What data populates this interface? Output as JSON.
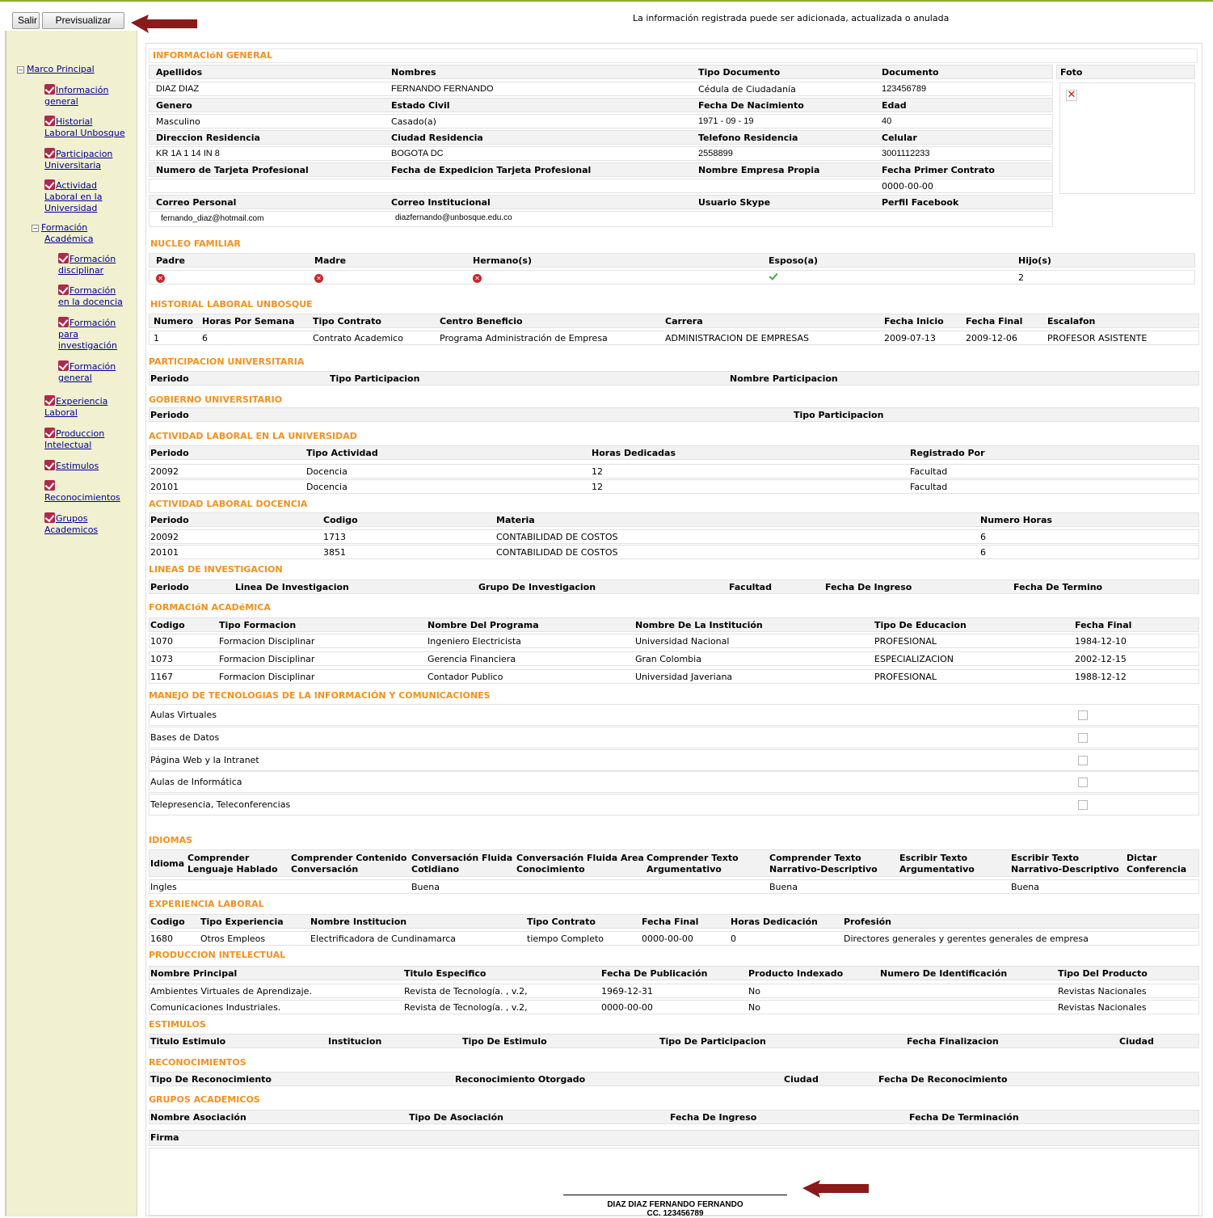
{
  "toolbar": {
    "exit_label": "Salir",
    "preview_label": "Previsualizar"
  },
  "notice": "La información registrada puede ser adicionada, actualizada o anulada",
  "tree": {
    "root": "Marco Principal",
    "items": [
      {
        "l1": "Información",
        "l2": "general"
      },
      {
        "l1": "Historial",
        "l2": "Laboral Unbosque"
      },
      {
        "l1": "Participacion",
        "l2": "Universitaria"
      },
      {
        "l1": "Actividad",
        "l2": "Laboral en la",
        "l3": "Universidad"
      },
      {
        "l1": "Formación",
        "l2": "Académica"
      },
      {
        "l1": "Formación",
        "l2": "disciplinar"
      },
      {
        "l1": "Formación",
        "l2": "en la docencia"
      },
      {
        "l1": "Formación",
        "l2": "para",
        "l3": "investigación"
      },
      {
        "l1": "Formación",
        "l2": "general"
      },
      {
        "l1": "Experiencia",
        "l2": "Laboral"
      },
      {
        "l1": "Produccion",
        "l2": "Intelectual"
      },
      {
        "l1": "Estimulos"
      },
      {
        "l1": "",
        "l2": "Reconocimientos"
      },
      {
        "l1": "Grupos",
        "l2": "Academicos"
      }
    ]
  },
  "general": {
    "title": "INFORMACIóN GENERAL",
    "h1": [
      "Apellidos",
      "Nombres",
      "Tipo Documento",
      "Documento",
      "Foto"
    ],
    "v1": [
      "DIAZ DIAZ",
      "FERNANDO FERNANDO",
      "Cédula de Ciudadanía",
      "123456789"
    ],
    "h2": [
      "Genero",
      "Estado Civil",
      "Fecha De Nacimiento",
      "Edad"
    ],
    "v2": [
      "Masculino",
      "Casado(a)",
      "1971 - 09 - 19",
      "40"
    ],
    "h3": [
      "Direccion Residencia",
      "Ciudad Residencia",
      "Telefono Residencia",
      "Celular"
    ],
    "v3": [
      "KR 1A 1 14 IN 8",
      "BOGOTA DC",
      "2558899",
      "3001112233"
    ],
    "h4": [
      "Numero de Tarjeta Profesional",
      "Fecha de Expedicion Tarjeta Profesional",
      "Nombre Empresa Propia",
      "Fecha Primer Contrato"
    ],
    "v4": [
      "",
      "",
      "",
      "0000-00-00"
    ],
    "h5": [
      "Correo Personal",
      "Correo Institucional",
      "Usuario Skype",
      "Perfil Facebook"
    ],
    "v5": [
      "fernando_diaz@hotmail.com",
      "diazfernando@unbosque.edu.co",
      "",
      ""
    ],
    "photo_missing": "✕"
  },
  "family": {
    "title": "NUCLEO FAMILIAR",
    "headers": [
      "Padre",
      "Madre",
      "Hermano(s)",
      "Esposo(a)",
      "Hijo(s)"
    ],
    "children_count": "2"
  },
  "history": {
    "title": "HISTORIAL LABORAL UNBOSQUE",
    "headers": [
      "Numero",
      "Horas Por Semana",
      "Tipo Contrato",
      "Centro Beneficio",
      "Carrera",
      "Fecha Inicio",
      "Fecha Final",
      "Escalafon"
    ],
    "row": [
      "1",
      "6",
      "Contrato Academico",
      "Programa Administración de Empresa",
      "ADMINISTRACION DE EMPRESAS",
      "2009-07-13",
      "2009-12-06",
      "PROFESOR ASISTENTE"
    ]
  },
  "participation": {
    "title": "PARTICIPACION UNIVERSITARIA",
    "headers": [
      "Periodo",
      "Tipo Participacion",
      "Nombre Participacion"
    ]
  },
  "government": {
    "title": "GOBIERNO UNIVERSITARIO",
    "headers": [
      "Periodo",
      "Tipo Participacion"
    ]
  },
  "activity": {
    "title": "ACTIVIDAD LABORAL EN LA UNIVERSIDAD",
    "headers": [
      "Periodo",
      "Tipo Actividad",
      "Horas Dedicadas",
      "Registrado Por"
    ],
    "rows": [
      [
        "20092",
        "Docencia",
        "12",
        "Facultad"
      ],
      [
        "20101",
        "Docencia",
        "12",
        "Facultad"
      ]
    ]
  },
  "teaching": {
    "title": "ACTIVIDAD LABORAL DOCENCIA",
    "headers": [
      "Periodo",
      "Codigo",
      "Materia",
      "Numero Horas"
    ],
    "rows": [
      [
        "20092",
        "1713",
        "CONTABILIDAD DE COSTOS",
        "6"
      ],
      [
        "20101",
        "3851",
        "CONTABILIDAD DE COSTOS",
        "6"
      ]
    ]
  },
  "research": {
    "title": "LINEAS DE INVESTIGACION",
    "headers": [
      "Periodo",
      "Linea De Investigacion",
      "Grupo De Investigacion",
      "Facultad",
      "Fecha De Ingreso",
      "Fecha De Termino"
    ]
  },
  "academic": {
    "title": "FORMACIóN ACADéMICA",
    "headers": [
      "Codigo",
      "Tipo Formacion",
      "Nombre Del Programa",
      "Nombre De La Institución",
      "Tipo De Educacion",
      "Fecha Final"
    ],
    "rows": [
      [
        "1070",
        "Formacion Disciplinar",
        "Ingeniero Electricista",
        "Universidad Nacional",
        "PROFESIONAL",
        "1984-12-10"
      ],
      [
        "1073",
        "Formacion Disciplinar",
        "Gerencia Financiera",
        "Gran Colombia",
        "ESPECIALIZACION",
        "2002-12-15"
      ],
      [
        "1167",
        "Formacion Disciplinar",
        "Contador Publico",
        "Universidad Javeriana",
        "PROFESIONAL",
        "1988-12-12"
      ]
    ]
  },
  "tic": {
    "title": "MANEJO DE TECNOLOGIAS DE LA INFORMACIÓN Y COMUNICACIONES",
    "items": [
      "Aulas Virtuales",
      "Bases de Datos",
      "Página Web y la Intranet",
      "Aulas de Informática",
      "Telepresencia, Teleconferencias"
    ]
  },
  "languages": {
    "title": "IDIOMAS",
    "headers": [
      [
        "Idioma"
      ],
      [
        "Comprender",
        "Lenguaje Hablado"
      ],
      [
        "Comprender Contenido",
        "Conversación"
      ],
      [
        "Conversación Fluida",
        "Cotidiano"
      ],
      [
        "Conversación Fluida Area",
        "Conocimiento"
      ],
      [
        "Comprender Texto",
        "Argumentativo"
      ],
      [
        "Comprender Texto",
        "Narrativo-Descriptivo"
      ],
      [
        "Escribir Texto",
        "Argumentativo"
      ],
      [
        "Escribir Texto",
        "Narrativo-Descriptivo"
      ],
      [
        "Dictar",
        "Conferencia"
      ]
    ],
    "row": [
      "Ingles",
      "",
      "",
      "Buena",
      "",
      "",
      "Buena",
      "",
      "Buena",
      ""
    ]
  },
  "experience": {
    "title": "EXPERIENCIA LABORAL",
    "headers": [
      "Codigo",
      "Tipo Experiencia",
      "Nombre Institucion",
      "Tipo Contrato",
      "Fecha Final",
      "Horas Dedicación",
      "Profesión"
    ],
    "row": [
      "1680",
      "Otros Empleos",
      "Electrificadora de Cundinamarca",
      "tiempo Completo",
      "0000-00-00",
      "0",
      "Directores generales y gerentes generales de empresa"
    ]
  },
  "production": {
    "title": "PRODUCCION INTELECTUAL",
    "headers": [
      "Nombre Principal",
      "Titulo Especifico",
      "Fecha De Publicación",
      "Producto Indexado",
      "Numero De Identificación",
      "Tipo Del Producto"
    ],
    "rows": [
      [
        "Ambientes Virtuales de Aprendizaje.",
        "Revista de Tecnología. , v.2,",
        "1969-12-31",
        "No",
        "",
        "Revistas Nacionales"
      ],
      [
        "Comunicaciones Industriales.",
        "Revista de Tecnología. , v.2,",
        "0000-00-00",
        "No",
        "",
        "Revistas Nacionales"
      ]
    ]
  },
  "stimuli": {
    "title": "ESTIMULOS",
    "headers": [
      "Titulo Estimulo",
      "Institucion",
      "Tipo De Estimulo",
      "Tipo De Participacion",
      "Fecha Finalizacion",
      "Ciudad"
    ]
  },
  "recognitions": {
    "title": "RECONOCIMIENTOS",
    "headers": [
      "Tipo De Reconocimiento",
      "Reconocimiento Otorgado",
      "Ciudad",
      "Fecha De Reconocimiento"
    ]
  },
  "groups": {
    "title": "GRUPOS ACADEMICOS",
    "headers": [
      "Nombre Asociación",
      "Tipo De Asociación",
      "Fecha De Ingreso",
      "Fecha De Terminación"
    ]
  },
  "signature": {
    "label": "Firma",
    "name": "DIAZ DIAZ FERNANDO FERNANDO",
    "id": "CC. 123456789"
  },
  "colors": {
    "section_title": "#f5901e",
    "sidebar_bg": "#f1f0d0",
    "link": "#00009a",
    "check": "#b0284c",
    "arrow": "#8b1a1a"
  }
}
